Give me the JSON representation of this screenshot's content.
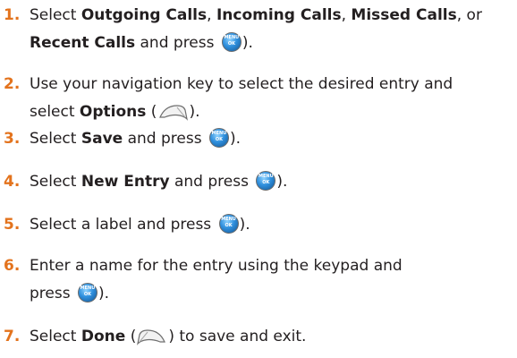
{
  "menu_key_text": {
    "top": "MENU",
    "bottom": "OK"
  },
  "steps": [
    {
      "number": "1.",
      "line1": [
        "Select ",
        "Outgoing Calls",
        ", ",
        "Incoming Calls",
        ", ",
        "Missed Calls",
        ", or"
      ],
      "line2": [
        "Recent Calls",
        " and press ",
        ")."
      ]
    },
    {
      "number": "2.",
      "line1": [
        "Use your navigation key to select the desired entry and"
      ],
      "line2": [
        "select ",
        "Options",
        " (",
        ")."
      ]
    },
    {
      "number": "3.",
      "line1": [
        "Select ",
        "Save",
        " and press ",
        ")."
      ]
    },
    {
      "number": "4.",
      "line1": [
        "Select ",
        "New Entry",
        " and press ",
        ")."
      ]
    },
    {
      "number": "5.",
      "line1": [
        "Select a label and press ",
        ")."
      ]
    },
    {
      "number": "6.",
      "line1": [
        "Enter a name for the entry using the keypad and"
      ],
      "line2": [
        "press ",
        ")."
      ]
    },
    {
      "number": "7.",
      "line1": [
        "Select ",
        "Done",
        " (",
        ") to save and exit."
      ]
    }
  ]
}
